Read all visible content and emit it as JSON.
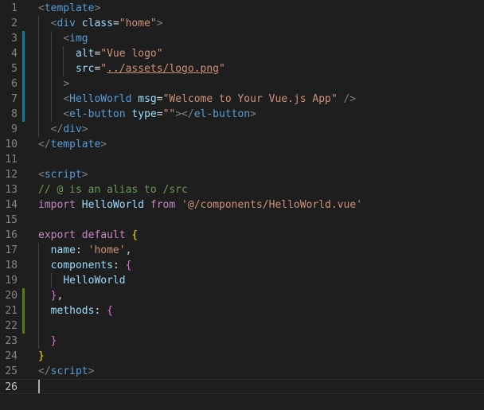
{
  "editor": {
    "colors": {
      "background": "#1e1e1e",
      "modified_marker": "#0c7d9d",
      "added_marker": "#587c0c"
    },
    "lines": [
      {
        "num": "1",
        "marker": "",
        "tokens": [
          {
            "t": "<",
            "c": "punct"
          },
          {
            "t": "template",
            "c": "tag"
          },
          {
            "t": ">",
            "c": "punct"
          }
        ]
      },
      {
        "num": "2",
        "marker": "",
        "tokens": [
          {
            "t": "  ",
            "c": "plain"
          },
          {
            "t": "<",
            "c": "punct"
          },
          {
            "t": "div",
            "c": "tag"
          },
          {
            "t": " ",
            "c": "plain"
          },
          {
            "t": "class",
            "c": "attr"
          },
          {
            "t": "=",
            "c": "plain"
          },
          {
            "t": "\"home\"",
            "c": "str"
          },
          {
            "t": ">",
            "c": "punct"
          }
        ]
      },
      {
        "num": "3",
        "marker": "modified",
        "tokens": [
          {
            "t": "    ",
            "c": "plain"
          },
          {
            "t": "<",
            "c": "punct"
          },
          {
            "t": "img",
            "c": "tag"
          }
        ]
      },
      {
        "num": "4",
        "marker": "modified",
        "tokens": [
          {
            "t": "      ",
            "c": "plain"
          },
          {
            "t": "alt",
            "c": "attr"
          },
          {
            "t": "=",
            "c": "plain"
          },
          {
            "t": "\"Vue logo\"",
            "c": "str"
          }
        ]
      },
      {
        "num": "5",
        "marker": "modified",
        "tokens": [
          {
            "t": "      ",
            "c": "plain"
          },
          {
            "t": "src",
            "c": "attr"
          },
          {
            "t": "=",
            "c": "plain"
          },
          {
            "t": "\"",
            "c": "str"
          },
          {
            "t": "../assets/logo.png",
            "c": "link"
          },
          {
            "t": "\"",
            "c": "str"
          }
        ]
      },
      {
        "num": "6",
        "marker": "modified",
        "tokens": [
          {
            "t": "    ",
            "c": "plain"
          },
          {
            "t": ">",
            "c": "punct"
          }
        ]
      },
      {
        "num": "7",
        "marker": "modified",
        "tokens": [
          {
            "t": "    ",
            "c": "plain"
          },
          {
            "t": "<",
            "c": "punct"
          },
          {
            "t": "HelloWorld",
            "c": "tag"
          },
          {
            "t": " ",
            "c": "plain"
          },
          {
            "t": "msg",
            "c": "attr"
          },
          {
            "t": "=",
            "c": "plain"
          },
          {
            "t": "\"Welcome to Your Vue.js App\"",
            "c": "str"
          },
          {
            "t": " />",
            "c": "punct"
          }
        ]
      },
      {
        "num": "8",
        "marker": "modified",
        "tokens": [
          {
            "t": "    ",
            "c": "plain"
          },
          {
            "t": "<",
            "c": "punct"
          },
          {
            "t": "el-button",
            "c": "tag"
          },
          {
            "t": " ",
            "c": "plain"
          },
          {
            "t": "type",
            "c": "attr"
          },
          {
            "t": "=",
            "c": "plain"
          },
          {
            "t": "\"\"",
            "c": "str"
          },
          {
            "t": "></",
            "c": "punct"
          },
          {
            "t": "el-button",
            "c": "tag"
          },
          {
            "t": ">",
            "c": "punct"
          }
        ]
      },
      {
        "num": "9",
        "marker": "",
        "tokens": [
          {
            "t": "  ",
            "c": "plain"
          },
          {
            "t": "</",
            "c": "punct"
          },
          {
            "t": "div",
            "c": "tag"
          },
          {
            "t": ">",
            "c": "punct"
          }
        ]
      },
      {
        "num": "10",
        "marker": "",
        "tokens": [
          {
            "t": "</",
            "c": "punct"
          },
          {
            "t": "template",
            "c": "tag"
          },
          {
            "t": ">",
            "c": "punct"
          }
        ]
      },
      {
        "num": "11",
        "marker": "",
        "tokens": []
      },
      {
        "num": "12",
        "marker": "",
        "tokens": [
          {
            "t": "<",
            "c": "punct"
          },
          {
            "t": "script",
            "c": "tag"
          },
          {
            "t": ">",
            "c": "punct"
          }
        ]
      },
      {
        "num": "13",
        "marker": "",
        "tokens": [
          {
            "t": "// @ is an alias to /src",
            "c": "comment"
          }
        ]
      },
      {
        "num": "14",
        "marker": "",
        "tokens": [
          {
            "t": "import",
            "c": "kw"
          },
          {
            "t": " ",
            "c": "plain"
          },
          {
            "t": "HelloWorld",
            "c": "var"
          },
          {
            "t": " ",
            "c": "plain"
          },
          {
            "t": "from",
            "c": "kw"
          },
          {
            "t": " ",
            "c": "plain"
          },
          {
            "t": "'@/components/HelloWorld.vue'",
            "c": "str"
          }
        ]
      },
      {
        "num": "15",
        "marker": "",
        "tokens": []
      },
      {
        "num": "16",
        "marker": "",
        "tokens": [
          {
            "t": "export",
            "c": "kw"
          },
          {
            "t": " ",
            "c": "plain"
          },
          {
            "t": "default",
            "c": "kw"
          },
          {
            "t": " ",
            "c": "plain"
          },
          {
            "t": "{",
            "c": "brace1"
          }
        ]
      },
      {
        "num": "17",
        "marker": "",
        "tokens": [
          {
            "t": "  ",
            "c": "plain"
          },
          {
            "t": "name",
            "c": "var"
          },
          {
            "t": ": ",
            "c": "plain"
          },
          {
            "t": "'home'",
            "c": "str"
          },
          {
            "t": ",",
            "c": "plain"
          }
        ]
      },
      {
        "num": "18",
        "marker": "",
        "tokens": [
          {
            "t": "  ",
            "c": "plain"
          },
          {
            "t": "components",
            "c": "var"
          },
          {
            "t": ": ",
            "c": "plain"
          },
          {
            "t": "{",
            "c": "brace2"
          }
        ]
      },
      {
        "num": "19",
        "marker": "",
        "tokens": [
          {
            "t": "    ",
            "c": "plain"
          },
          {
            "t": "HelloWorld",
            "c": "var"
          }
        ]
      },
      {
        "num": "20",
        "marker": "added",
        "tokens": [
          {
            "t": "  ",
            "c": "plain"
          },
          {
            "t": "}",
            "c": "brace2"
          },
          {
            "t": ",",
            "c": "plain"
          }
        ]
      },
      {
        "num": "21",
        "marker": "added",
        "tokens": [
          {
            "t": "  ",
            "c": "plain"
          },
          {
            "t": "methods",
            "c": "var"
          },
          {
            "t": ": ",
            "c": "plain"
          },
          {
            "t": "{",
            "c": "brace2"
          }
        ]
      },
      {
        "num": "22",
        "marker": "added",
        "tokens": []
      },
      {
        "num": "23",
        "marker": "",
        "tokens": [
          {
            "t": "  ",
            "c": "plain"
          },
          {
            "t": "}",
            "c": "brace2"
          }
        ]
      },
      {
        "num": "24",
        "marker": "",
        "tokens": [
          {
            "t": "}",
            "c": "brace1"
          }
        ]
      },
      {
        "num": "25",
        "marker": "",
        "tokens": [
          {
            "t": "</",
            "c": "punct"
          },
          {
            "t": "script",
            "c": "tag"
          },
          {
            "t": ">",
            "c": "punct"
          }
        ]
      },
      {
        "num": "26",
        "marker": "",
        "tokens": [],
        "current": true
      }
    ]
  }
}
